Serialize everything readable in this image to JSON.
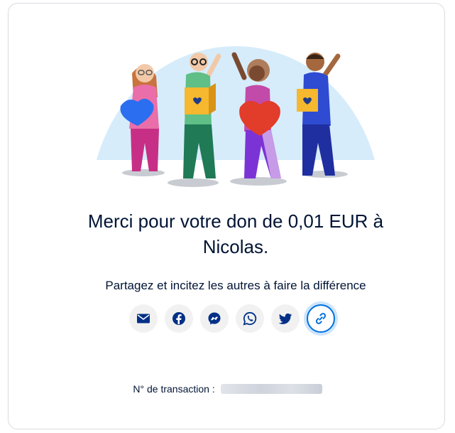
{
  "confirmation": {
    "title_line1": "Merci pour votre don de 0,01 EUR à",
    "title_line2": "Nicolas.",
    "subtitle": "Partagez et incitez les autres à faire la différence"
  },
  "share": {
    "buttons": [
      {
        "icon": "envelope-icon",
        "target": "email"
      },
      {
        "icon": "facebook-icon",
        "target": "facebook"
      },
      {
        "icon": "messenger-icon",
        "target": "messenger"
      },
      {
        "icon": "whatsapp-icon",
        "target": "whatsapp"
      },
      {
        "icon": "twitter-icon",
        "target": "twitter"
      },
      {
        "icon": "link-icon",
        "target": "copy-link",
        "selected": true
      }
    ]
  },
  "transaction": {
    "label": "N° de transaction :"
  },
  "colors": {
    "text": "#001435",
    "icon": "#003087",
    "accent": "#0070e0",
    "illustration_background": "#d6ecfb"
  }
}
